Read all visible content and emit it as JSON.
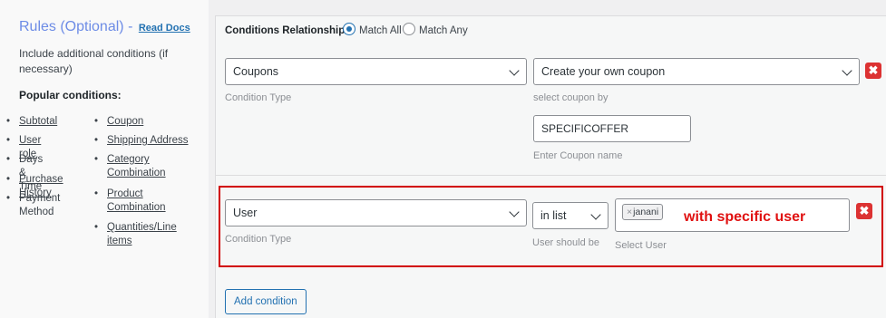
{
  "sidebar": {
    "title": "Rules (Optional)",
    "separator": "-",
    "read_docs": "Read Docs",
    "description": "Include additional conditions (if necessary)",
    "popular_heading": "Popular conditions:",
    "left_items": [
      "Subtotal",
      "User role",
      "Days & Time",
      "Purchase History",
      "Payment Method"
    ],
    "right_items": [
      "Coupon",
      "Shipping Address",
      "Category Combination",
      "Product Combination",
      "Quantities/Line items"
    ]
  },
  "relationship": {
    "label": "Conditions Relationship",
    "option_all": "Match All",
    "option_any": "Match Any",
    "selected": "Match All"
  },
  "condition1": {
    "type_value": "Coupons",
    "type_hint": "Condition Type",
    "coupon_mode": "Create your own coupon",
    "coupon_mode_hint": "select coupon by",
    "coupon_name": "SPECIFICOFFER",
    "coupon_name_hint": "Enter Coupon name"
  },
  "condition2": {
    "type_value": "User",
    "type_hint": "Condition Type",
    "operator": "in list",
    "operator_hint": "User should be",
    "tag": "janani",
    "tag_remove": "×",
    "users_hint": "Select User",
    "annotation": "with specific user"
  },
  "delete_symbol": "✖",
  "add_condition": "Add condition",
  "colors": {
    "accent": "#2271b1",
    "delete": "#dc3232",
    "highlight": "#d10000",
    "annotation": "#e01010",
    "title": "#6d8ce6"
  }
}
